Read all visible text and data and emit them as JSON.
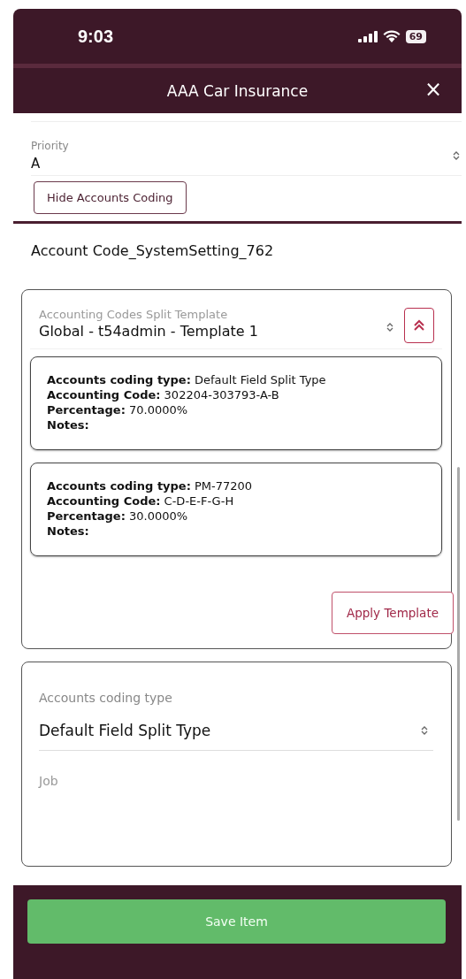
{
  "status_bar": {
    "time": "9:03",
    "battery": "69"
  },
  "header": {
    "title": "AAA Car Insurance",
    "close": "×"
  },
  "priority": {
    "label": "Priority",
    "value": "A"
  },
  "toggle_button": "Hide Accounts Coding",
  "section_title": "Account Code_SystemSetting_762",
  "template": {
    "label": "Accounting Codes Split Template",
    "value": "Global - t54admin - Template 1",
    "expanded": true,
    "splits": [
      {
        "fields": [
          {
            "label": "Accounts coding type:",
            "value": "Default Field Split Type"
          },
          {
            "label": "Accounting Code:",
            "value": "302204-303793-A-B"
          },
          {
            "label": "Percentage:",
            "value": "70.0000%"
          },
          {
            "label": "Notes:"
          }
        ]
      },
      {
        "fields": [
          {
            "label": "Accounts coding type:",
            "value": "PM-77200"
          },
          {
            "label": "Accounting Code:",
            "value": "C-D-E-F-G-H"
          },
          {
            "label": "Percentage:",
            "value": "30.0000%"
          },
          {
            "label": "Notes:"
          }
        ]
      }
    ],
    "apply_button": "Apply Template"
  },
  "coding": {
    "type_label": "Accounts coding type",
    "type_value": "Default Field Split Type",
    "job_label": "Job"
  },
  "footer": {
    "save_button": "Save Item"
  }
}
